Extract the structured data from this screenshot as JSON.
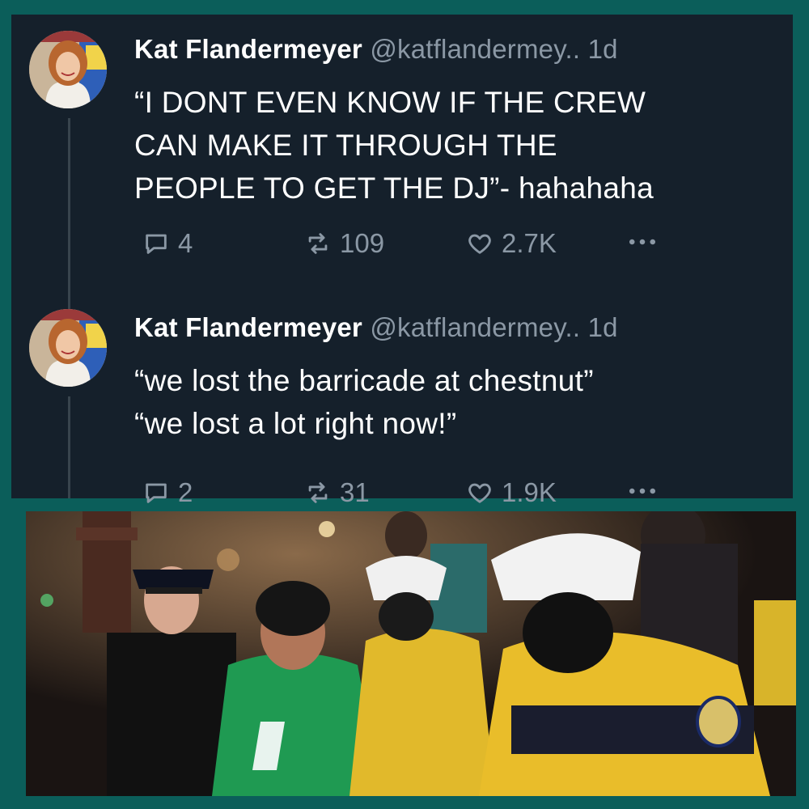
{
  "colors": {
    "frame": "#0b5e5a",
    "panel": "#15202b",
    "text": "#ffffff",
    "muted": "#8b98a5"
  },
  "tweets": [
    {
      "name": "Kat Flandermeyer",
      "handle": "@katflandermey..",
      "time": "1d",
      "lines": [
        "“I DONT EVEN KNOW IF THE CREW",
        "CAN MAKE IT THROUGH THE",
        "PEOPLE TO GET THE DJ”- hahahaha"
      ],
      "replies": "4",
      "retweets": "109",
      "likes": "2.7K",
      "icons": [
        "reply-icon",
        "retweet-icon",
        "like-icon",
        "more-icon"
      ]
    },
    {
      "name": "Kat Flandermeyer",
      "handle": "@katflandermey..",
      "time": "1d",
      "lines": [
        "“we lost the barricade at chestnut”",
        "“we lost a lot right now!”"
      ],
      "replies": "2",
      "retweets": "31",
      "likes": "1.9K",
      "icons": [
        "reply-icon",
        "retweet-icon",
        "like-icon",
        "more-icon"
      ]
    }
  ]
}
